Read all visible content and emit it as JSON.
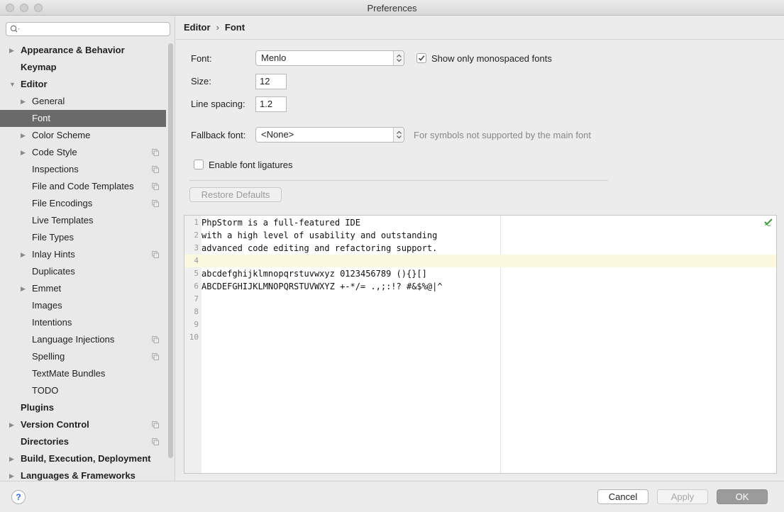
{
  "window": {
    "title": "Preferences"
  },
  "sidebar": {
    "search_placeholder": "",
    "items": [
      {
        "label": "Appearance & Behavior",
        "bold": true,
        "arrow": "right",
        "indent": 0,
        "copy": false,
        "selected": false
      },
      {
        "label": "Keymap",
        "bold": true,
        "arrow": "",
        "indent": 0,
        "copy": false,
        "selected": false
      },
      {
        "label": "Editor",
        "bold": true,
        "arrow": "down",
        "indent": 0,
        "copy": false,
        "selected": false
      },
      {
        "label": "General",
        "bold": false,
        "arrow": "right",
        "indent": 1,
        "copy": false,
        "selected": false
      },
      {
        "label": "Font",
        "bold": false,
        "arrow": "",
        "indent": 1,
        "copy": false,
        "selected": true
      },
      {
        "label": "Color Scheme",
        "bold": false,
        "arrow": "right",
        "indent": 1,
        "copy": false,
        "selected": false
      },
      {
        "label": "Code Style",
        "bold": false,
        "arrow": "right",
        "indent": 1,
        "copy": true,
        "selected": false
      },
      {
        "label": "Inspections",
        "bold": false,
        "arrow": "",
        "indent": 1,
        "copy": true,
        "selected": false
      },
      {
        "label": "File and Code Templates",
        "bold": false,
        "arrow": "",
        "indent": 1,
        "copy": true,
        "selected": false
      },
      {
        "label": "File Encodings",
        "bold": false,
        "arrow": "",
        "indent": 1,
        "copy": true,
        "selected": false
      },
      {
        "label": "Live Templates",
        "bold": false,
        "arrow": "",
        "indent": 1,
        "copy": false,
        "selected": false
      },
      {
        "label": "File Types",
        "bold": false,
        "arrow": "",
        "indent": 1,
        "copy": false,
        "selected": false
      },
      {
        "label": "Inlay Hints",
        "bold": false,
        "arrow": "right",
        "indent": 1,
        "copy": true,
        "selected": false
      },
      {
        "label": "Duplicates",
        "bold": false,
        "arrow": "",
        "indent": 1,
        "copy": false,
        "selected": false
      },
      {
        "label": "Emmet",
        "bold": false,
        "arrow": "right",
        "indent": 1,
        "copy": false,
        "selected": false
      },
      {
        "label": "Images",
        "bold": false,
        "arrow": "",
        "indent": 1,
        "copy": false,
        "selected": false
      },
      {
        "label": "Intentions",
        "bold": false,
        "arrow": "",
        "indent": 1,
        "copy": false,
        "selected": false
      },
      {
        "label": "Language Injections",
        "bold": false,
        "arrow": "",
        "indent": 1,
        "copy": true,
        "selected": false
      },
      {
        "label": "Spelling",
        "bold": false,
        "arrow": "",
        "indent": 1,
        "copy": true,
        "selected": false
      },
      {
        "label": "TextMate Bundles",
        "bold": false,
        "arrow": "",
        "indent": 1,
        "copy": false,
        "selected": false
      },
      {
        "label": "TODO",
        "bold": false,
        "arrow": "",
        "indent": 1,
        "copy": false,
        "selected": false
      },
      {
        "label": "Plugins",
        "bold": true,
        "arrow": "",
        "indent": 0,
        "copy": false,
        "selected": false
      },
      {
        "label": "Version Control",
        "bold": true,
        "arrow": "right",
        "indent": 0,
        "copy": true,
        "selected": false
      },
      {
        "label": "Directories",
        "bold": true,
        "arrow": "",
        "indent": 0,
        "copy": true,
        "selected": false
      },
      {
        "label": "Build, Execution, Deployment",
        "bold": true,
        "arrow": "right",
        "indent": 0,
        "copy": false,
        "selected": false
      },
      {
        "label": "Languages & Frameworks",
        "bold": true,
        "arrow": "right",
        "indent": 0,
        "copy": false,
        "selected": false
      }
    ]
  },
  "breadcrumb": {
    "parent": "Editor",
    "separator": "›",
    "current": "Font"
  },
  "form": {
    "font_label": "Font:",
    "font_value": "Menlo",
    "monospace_label": "Show only monospaced fonts",
    "monospace_checked": true,
    "size_label": "Size:",
    "size_value": "12",
    "spacing_label": "Line spacing:",
    "spacing_value": "1.2",
    "fallback_label": "Fallback font:",
    "fallback_value": "<None>",
    "fallback_hint": "For symbols not supported by the main font",
    "ligatures_label": "Enable font ligatures",
    "ligatures_checked": false,
    "restore_label": "Restore Defaults"
  },
  "preview": {
    "current_line": 4,
    "lines": [
      {
        "n": "1",
        "text": "PhpStorm is a full-featured IDE"
      },
      {
        "n": "2",
        "text": "with a high level of usability and outstanding"
      },
      {
        "n": "3",
        "text": "advanced code editing and refactoring support."
      },
      {
        "n": "4",
        "text": ""
      },
      {
        "n": "5",
        "text": "abcdefghijklmnopqrstuvwxyz 0123456789 (){}[]"
      },
      {
        "n": "6",
        "text": "ABCDEFGHIJKLMNOPQRSTUVWXYZ +-*/= .,;:!? #&$%@|^"
      },
      {
        "n": "7",
        "text": ""
      },
      {
        "n": "8",
        "text": ""
      },
      {
        "n": "9",
        "text": ""
      },
      {
        "n": "10",
        "text": ""
      }
    ]
  },
  "footer": {
    "help_label": "?",
    "cancel_label": "Cancel",
    "apply_label": "Apply",
    "ok_label": "OK"
  },
  "colors": {
    "selected_bg": "#6a6a6a",
    "current_line_bg": "#fcf9e1",
    "check_green": "#3b9a3b",
    "help_blue": "#2a6fd6"
  }
}
